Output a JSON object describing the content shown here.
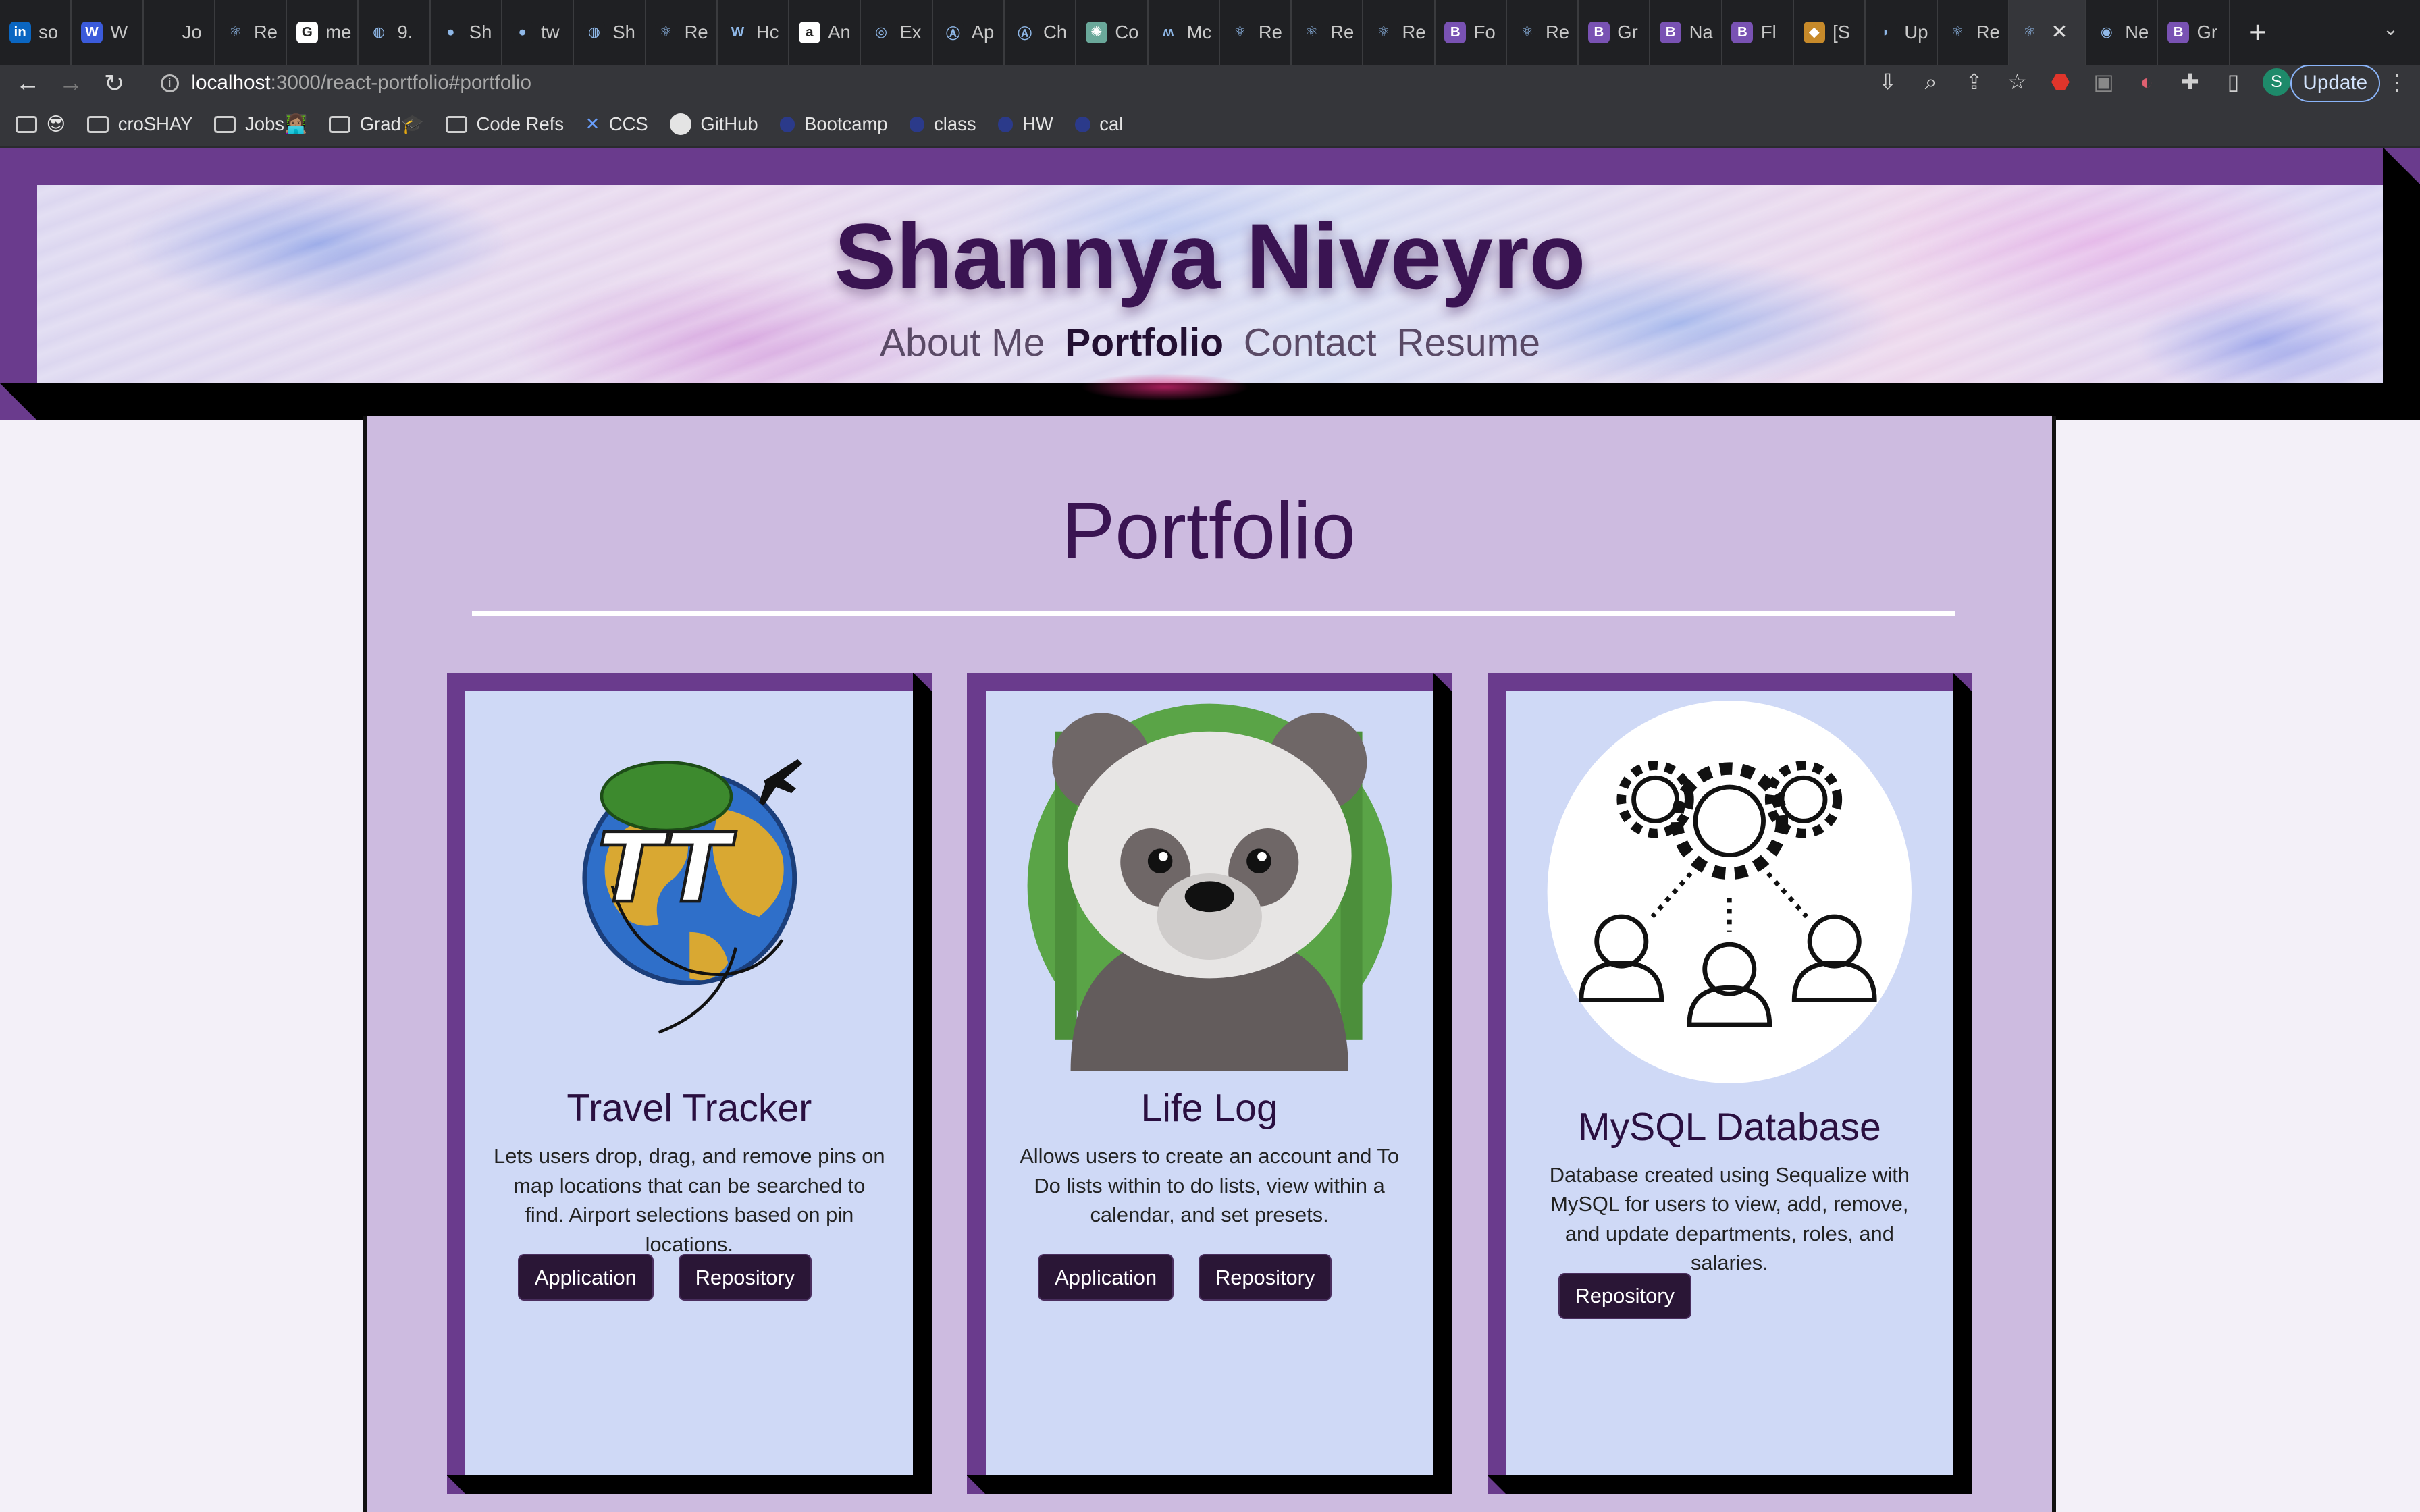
{
  "browser": {
    "tabs": [
      {
        "icon": "linkedin-icon",
        "label": "so",
        "color": "#0a66c2",
        "glyph": "in"
      },
      {
        "icon": "webflow-icon",
        "label": "W",
        "color": "#3b5bdb",
        "glyph": "W"
      },
      {
        "icon": "blank-icon",
        "label": "Jo",
        "color": "#1f2023",
        "glyph": ""
      },
      {
        "icon": "react-icon",
        "label": "Re",
        "color": "#1f2023",
        "glyph": "⚛"
      },
      {
        "icon": "google-icon",
        "label": "me",
        "color": "#ffffff",
        "glyph": "G"
      },
      {
        "icon": "globe-icon",
        "label": "9.",
        "color": "#1f2023",
        "glyph": "◍"
      },
      {
        "icon": "github-icon",
        "label": "Sh",
        "color": "#1f2023",
        "glyph": "●"
      },
      {
        "icon": "github-icon",
        "label": "tw",
        "color": "#1f2023",
        "glyph": "●"
      },
      {
        "icon": "globe-icon",
        "label": "Sh",
        "color": "#1f2023",
        "glyph": "◍"
      },
      {
        "icon": "react-icon",
        "label": "Re",
        "color": "#1f2023",
        "glyph": "⚛"
      },
      {
        "icon": "w-icon",
        "label": "Hc",
        "color": "#1f2023",
        "glyph": "W"
      },
      {
        "icon": "amazon-icon",
        "label": "An",
        "color": "#ffffff",
        "glyph": "a"
      },
      {
        "icon": "ex-icon",
        "label": "Ex",
        "color": "#1f2023",
        "glyph": "◎"
      },
      {
        "icon": "a-icon",
        "label": "Ap",
        "color": "#1f2023",
        "glyph": "Ⓐ"
      },
      {
        "icon": "a-icon",
        "label": "Ch",
        "color": "#1f2023",
        "glyph": "Ⓐ"
      },
      {
        "icon": "chatgpt-icon",
        "label": "Co",
        "color": "#6aa89a",
        "glyph": "✺"
      },
      {
        "icon": "m-icon",
        "label": "Mc",
        "color": "#1f2023",
        "glyph": "ʍ"
      },
      {
        "icon": "react-icon",
        "label": "Re",
        "color": "#1f2023",
        "glyph": "⚛"
      },
      {
        "icon": "react-icon",
        "label": "Re",
        "color": "#1f2023",
        "glyph": "⚛"
      },
      {
        "icon": "react-icon",
        "label": "Re",
        "color": "#1f2023",
        "glyph": "⚛"
      },
      {
        "icon": "bootstrap-icon",
        "label": "Fo",
        "color": "#7952b3",
        "glyph": "B"
      },
      {
        "icon": "react-icon",
        "label": "Re",
        "color": "#1f2023",
        "glyph": "⚛"
      },
      {
        "icon": "bootstrap-icon",
        "label": "Gr",
        "color": "#7952b3",
        "glyph": "B"
      },
      {
        "icon": "bootstrap-icon",
        "label": "Na",
        "color": "#7952b3",
        "glyph": "B"
      },
      {
        "icon": "bootstrap-icon",
        "label": "Fl",
        "color": "#7952b3",
        "glyph": "B"
      },
      {
        "icon": "image-icon",
        "label": "[S",
        "color": "#c78a2a",
        "glyph": "◆"
      },
      {
        "icon": "bee-icon",
        "label": "Up",
        "color": "#1f2023",
        "glyph": "◗"
      },
      {
        "icon": "react-icon",
        "label": "Re",
        "color": "#1f2023",
        "glyph": "⚛"
      }
    ],
    "active_tab": {
      "icon": "react-icon",
      "close": "✕"
    },
    "after_tabs": [
      {
        "icon": "chrome-icon",
        "label": "Ne",
        "color": "#1f2023",
        "glyph": "◉"
      },
      {
        "icon": "bootstrap-icon",
        "label": "Gr",
        "color": "#7952b3",
        "glyph": "B"
      }
    ],
    "new_tab": "+",
    "tab_menu": "⌄",
    "url_host": "localhost",
    "url_path": ":3000/react-portfolio#portfolio",
    "profile_initial": "S",
    "update_label": "Update",
    "bookmarks": [
      {
        "type": "folder",
        "label": "😎"
      },
      {
        "type": "folder",
        "label": "croSHAY"
      },
      {
        "type": "folder",
        "label": "Jobs👩🏽‍💻"
      },
      {
        "type": "folder",
        "label": "Grad🎓"
      },
      {
        "type": "folder",
        "label": "Code Refs"
      },
      {
        "type": "link",
        "label": "CCS"
      },
      {
        "type": "github",
        "label": "GitHub"
      },
      {
        "type": "dot",
        "label": "Bootcamp"
      },
      {
        "type": "dot",
        "label": "class"
      },
      {
        "type": "dot",
        "label": "HW"
      },
      {
        "type": "dot",
        "label": "cal"
      }
    ]
  },
  "site": {
    "title": "Shannya Niveyro",
    "nav": [
      {
        "label": "About Me",
        "active": false
      },
      {
        "label": "Portfolio",
        "active": true
      },
      {
        "label": "Contact",
        "active": false
      },
      {
        "label": "Resume",
        "active": false
      }
    ],
    "colors": {
      "accent": "#6a3b8d",
      "title": "#3a1452",
      "button": "#2a1636"
    }
  },
  "portfolio": {
    "heading": "Portfolio",
    "projects": [
      {
        "title": "Travel Tracker",
        "image": "travel-tracker-globe-logo",
        "description": "Lets users drop, drag, and remove pins on map locations that can be searched to find. Airport selections based on pin locations.",
        "buttons": [
          "Application",
          "Repository"
        ]
      },
      {
        "title": "Life Log",
        "image": "panda-illustration",
        "description": "Allows users to create an account and To Do lists within to do lists, view within a calendar, and set presets.",
        "buttons": [
          "Application",
          "Repository"
        ]
      },
      {
        "title": "MySQL Database",
        "image": "gears-and-users-illustration",
        "description": "Database created using Sequalize with MySQL for users to view, add, remove, and update departments, roles, and salaries.",
        "buttons": [
          "Repository"
        ]
      }
    ]
  }
}
